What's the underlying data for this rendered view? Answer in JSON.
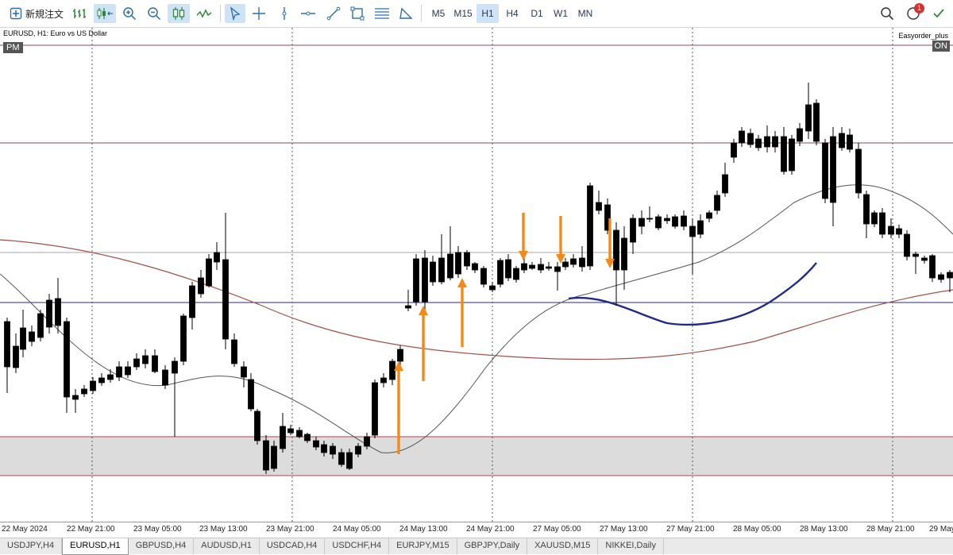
{
  "toolbar": {
    "new_order_label": "新規注文",
    "timeframes": [
      "M5",
      "M15",
      "H1",
      "H4",
      "D1",
      "W1",
      "MN"
    ],
    "active_timeframe": "H1",
    "notification_count": "1"
  },
  "chart": {
    "symbol_label": "EURUSD, H1:  Euro vs US Dollar",
    "pm_label": "PM",
    "ea_label": "Easyorder_plus",
    "on_label": "ON",
    "x_labels": [
      "22 May 2024",
      "22 May 21:00",
      "23 May 05:00",
      "23 May 13:00",
      "23 May 21:00",
      "24 May 05:00",
      "24 May 13:00",
      "24 May 21:00",
      "27 May 05:00",
      "27 May 13:00",
      "27 May 21:00",
      "28 May 05:00",
      "28 May 13:00",
      "28 May 21:00",
      "29 May"
    ]
  },
  "colors": {
    "bull_candle": "#ffffff",
    "bear_candle": "#000000",
    "annotation_arrow": "#f28a1a",
    "support_zone": "#dcdcdc",
    "zone_line": "#b54545",
    "ma_fast": "#555555",
    "ma_slow": "#a0524a",
    "ma_drawn": "#1f2a8a"
  },
  "tabs": [
    "USDJPY,H4",
    "EURUSD,H1",
    "GBPUSD,H4",
    "AUDUSD,H1",
    "USDCAD,H4",
    "USDCHF,H4",
    "EURJPY,M15",
    "GBPJPY,Daily",
    "XAUUSD,M15",
    "NIKKEI,Daily"
  ],
  "active_tab": "EURUSD,H1"
}
